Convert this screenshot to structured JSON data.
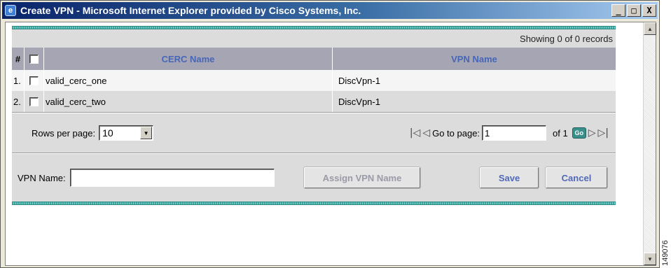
{
  "window": {
    "title": "Create VPN - Microsoft Internet Explorer provided by Cisco Systems, Inc.",
    "icon": "ie-icon",
    "controls": [
      "_",
      "□",
      "X"
    ]
  },
  "records_text": "Showing 0 of 0 records",
  "table": {
    "columns": [
      "#",
      "CERC Name",
      "VPN Name"
    ],
    "rows": [
      {
        "num": "1.",
        "cerc": "valid_cerc_one",
        "vpn": "DiscVpn-1"
      },
      {
        "num": "2.",
        "cerc": "valid_cerc_two",
        "vpn": "DiscVpn-1"
      }
    ]
  },
  "pager": {
    "rows_label": "Rows per page:",
    "rows_value": "10",
    "goto_label": "Go to page:",
    "page_value": "1",
    "of_text": "of 1",
    "go_label": "Go"
  },
  "form": {
    "vpn_label": "VPN Name:",
    "vpn_value": "",
    "assign_label": "Assign VPN Name",
    "save_label": "Save",
    "cancel_label": "Cancel"
  },
  "figure_id": "149076"
}
